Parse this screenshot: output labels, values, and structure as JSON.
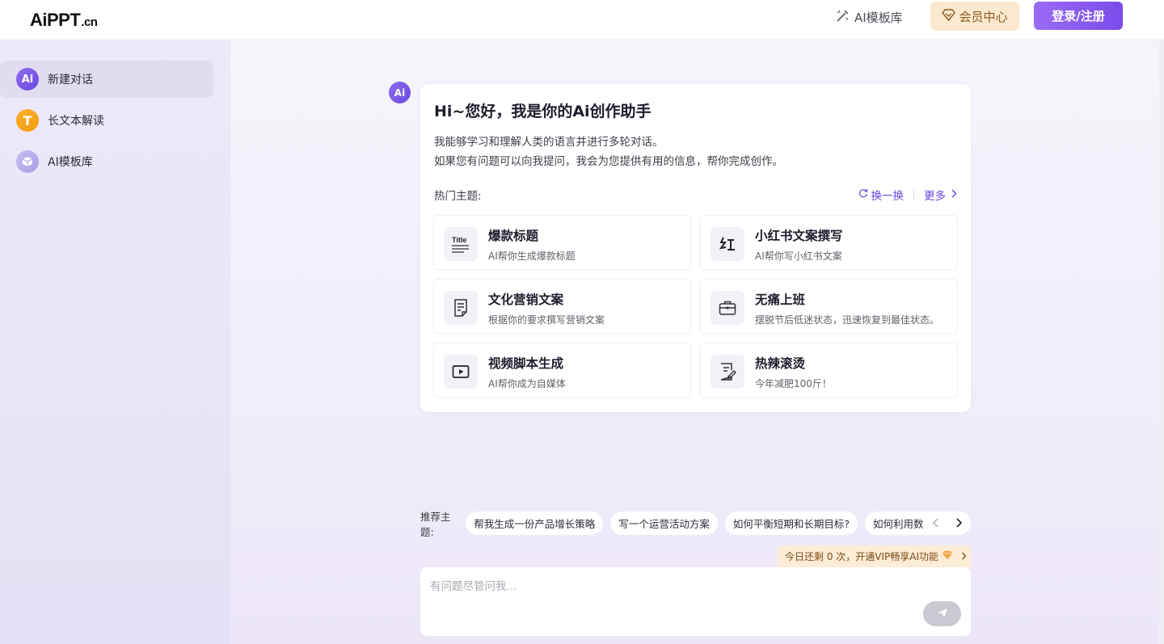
{
  "header": {
    "logo_main": "AiPPT",
    "logo_suffix": ".cn",
    "templates_label": "AI模板库",
    "vip_label": "会员中心",
    "login_label": "登录/注册"
  },
  "sidebar": {
    "items": [
      {
        "label": "新建对话",
        "icon": "ai-chat-icon",
        "icon_text": "Ai"
      },
      {
        "label": "长文本解读",
        "icon": "long-text-icon",
        "icon_text": "T"
      },
      {
        "label": "AI模板库",
        "icon": "template-box-icon",
        "icon_text": ""
      }
    ]
  },
  "welcome": {
    "avatar_text": "Ai",
    "title": "Hi~您好，我是你的Ai创作助手",
    "desc_line1": "我能够学习和理解人类的语言并进行多轮对话。",
    "desc_line2": "如果您有问题可以向我提问，我会为您提供有用的信息，帮你完成创作。",
    "hot_label": "热门主题:",
    "refresh_label": "换一换",
    "more_label": "更多",
    "topics": [
      {
        "title": "爆款标题",
        "sub": "AI帮你生成爆款标题",
        "icon": "title-doc-icon"
      },
      {
        "title": "小红书文案撰写",
        "sub": "AI帮你写小红书文案",
        "icon": "red-char-icon"
      },
      {
        "title": "文化营销文案",
        "sub": "根据你的要求撰写营销文案",
        "icon": "document-icon"
      },
      {
        "title": "无痛上班",
        "sub": "摆脱节后低迷状态，迅速恢复到最佳状态。",
        "icon": "briefcase-icon"
      },
      {
        "title": "视频脚本生成",
        "sub": "AI帮你成为自媒体",
        "icon": "video-play-icon"
      },
      {
        "title": "热辣滚烫",
        "sub": "今年减肥100斤！",
        "icon": "edit-note-icon"
      }
    ]
  },
  "recommend": {
    "label": "推荐主题:",
    "chips": [
      "帮我生成一份产品增长策略",
      "写一个运营活动方案",
      "如何平衡短期和长期目标?",
      "如何利用数"
    ]
  },
  "vip_tip": {
    "text": "今日还剩 0 次，开通VIP畅享AI功能"
  },
  "input": {
    "placeholder": "有问题尽管问我..."
  },
  "colors": {
    "brand": "#7b4bea",
    "vip_bg": "#fbe9cf",
    "sidebar_bg": "#ede9f8"
  }
}
